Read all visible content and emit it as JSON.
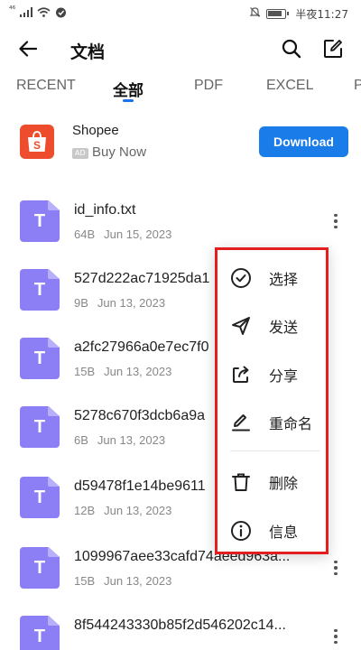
{
  "status_bar": {
    "signal_label": "⁴⁶",
    "time_label": "半夜11:27",
    "icons": [
      "signal-icon",
      "wifi-icon",
      "data-icon",
      "mute-icon",
      "battery-icon"
    ]
  },
  "header": {
    "title": "文档",
    "icons": [
      "back-arrow-icon",
      "search-icon",
      "new-document-icon"
    ]
  },
  "tabs": [
    {
      "label": "RECENT",
      "active": false
    },
    {
      "label": "全部",
      "active": true
    },
    {
      "label": "PDF",
      "active": false
    },
    {
      "label": "EXCEL",
      "active": false
    },
    {
      "label": "P",
      "active": false
    }
  ],
  "ad": {
    "name": "Shopee",
    "tag": "AD",
    "cta_text": "Buy Now",
    "button_label": "Download",
    "brand_color": "#ee4d2d",
    "button_color": "#1a7ce8"
  },
  "files": [
    {
      "icon_letter": "T",
      "name": "id_info.txt",
      "size": "64B",
      "date": "Jun 15, 2023"
    },
    {
      "icon_letter": "T",
      "name": "527d222ac71925da1",
      "size": "9B",
      "date": "Jun 13, 2023"
    },
    {
      "icon_letter": "T",
      "name": "a2fc27966a0e7ec7f0",
      "size": "15B",
      "date": "Jun 13, 2023"
    },
    {
      "icon_letter": "T",
      "name": "5278c670f3dcb6a9a",
      "size": "6B",
      "date": "Jun 13, 2023"
    },
    {
      "icon_letter": "T",
      "name": "d59478f1e14be9611",
      "size": "12B",
      "date": "Jun 13, 2023"
    },
    {
      "icon_letter": "T",
      "name": "1099967aee33cafd74aeed963a...",
      "size": "15B",
      "date": "Jun 13, 2023"
    },
    {
      "icon_letter": "T",
      "name": "8f544243330b85f2d546202c14...",
      "size": "",
      "date": ""
    }
  ],
  "context_menu": {
    "highlight_color": "#e41e1e",
    "items": [
      {
        "label": "选择",
        "icon": "check-circle-icon"
      },
      {
        "label": "发送",
        "icon": "send-icon"
      },
      {
        "label": "分享",
        "icon": "share-icon"
      },
      {
        "label": "重命名",
        "icon": "rename-icon"
      },
      {
        "label": "删除",
        "icon": "delete-icon"
      },
      {
        "label": "信息",
        "icon": "info-icon"
      }
    ]
  }
}
